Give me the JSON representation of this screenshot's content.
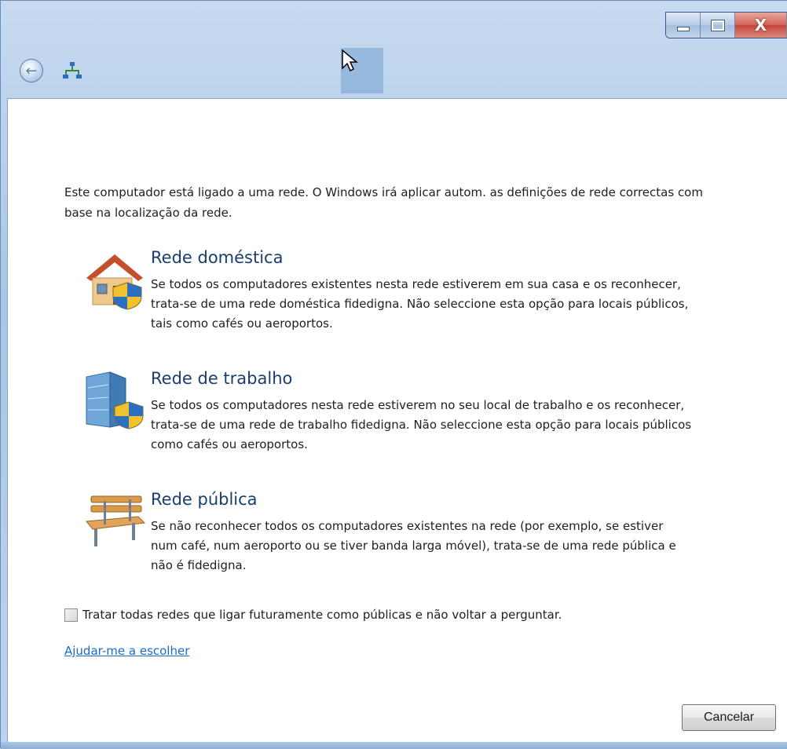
{
  "window": {
    "caption": {
      "minimize_icon": "minimize-icon",
      "maximize_icon": "maximize-icon",
      "close_glyph": "X"
    },
    "nav": {
      "back_icon": "back-arrow-icon",
      "network_icon": "network-icon"
    }
  },
  "intro_text": "Este computador está ligado a uma rede. O Windows irá aplicar autom. as definições de rede correctas com base na localização da rede.",
  "options": [
    {
      "title": "Rede doméstica",
      "description": "Se todos os computadores existentes nesta rede estiverem em sua casa e os reconhecer, trata-se de uma rede doméstica fidedigna. Não seleccione esta opção para locais públicos, tais como cafés ou aeroportos.",
      "icon": "home-network-icon"
    },
    {
      "title": "Rede de trabalho",
      "description": "Se todos os computadores nesta rede estiverem no seu local de trabalho e os reconhecer, trata-se de uma rede de trabalho fidedigna. Não seleccione esta opção para locais públicos como cafés ou aeroportos.",
      "icon": "work-network-icon"
    },
    {
      "title": "Rede pública",
      "description": "Se não reconhecer todos os computadores existentes na rede (por exemplo, se estiver num café, num aeroporto ou se tiver banda larga móvel), trata-se de uma rede pública e não é fidedigna.",
      "icon": "public-network-icon"
    }
  ],
  "checkbox": {
    "label": "Tratar todas redes que ligar futuramente como públicas e não voltar a perguntar.",
    "checked": false
  },
  "help_link": "Ajudar-me a escolher",
  "cancel_label": "Cancelar",
  "colors": {
    "title_blue": "#1a3f6e",
    "link_blue": "#1a6bc4"
  }
}
